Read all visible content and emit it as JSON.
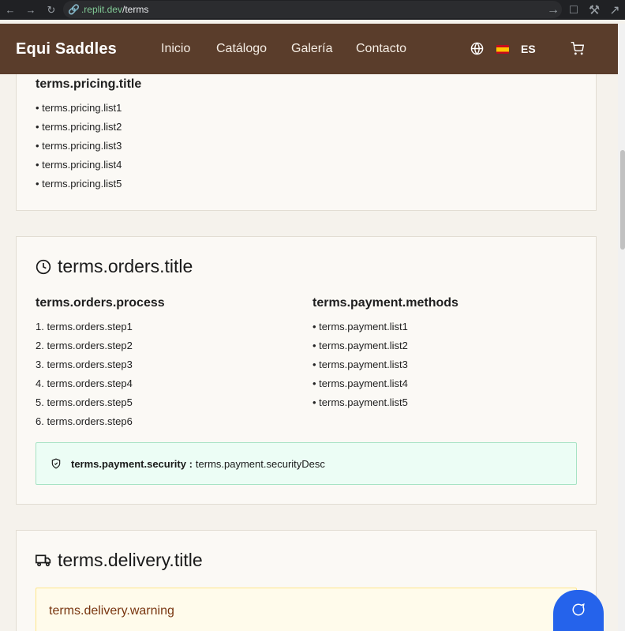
{
  "browser": {
    "url_domain": ".replit.dev",
    "url_path": "/terms"
  },
  "header": {
    "brand": "Equi Saddles",
    "nav": [
      "Inicio",
      "Catálogo",
      "Galería",
      "Contacto"
    ],
    "language": "ES"
  },
  "pricing": {
    "title": "terms.pricing.title",
    "items": [
      "terms.pricing.list1",
      "terms.pricing.list2",
      "terms.pricing.list3",
      "terms.pricing.list4",
      "terms.pricing.list5"
    ]
  },
  "orders": {
    "title": "terms.orders.title",
    "process_title": "terms.orders.process",
    "steps": [
      "1. terms.orders.step1",
      "2. terms.orders.step2",
      "3. terms.orders.step3",
      "4. terms.orders.step4",
      "5. terms.orders.step5",
      "6. terms.orders.step6"
    ],
    "payment_title": "terms.payment.methods",
    "payment_items": [
      "terms.payment.list1",
      "terms.payment.list2",
      "terms.payment.list3",
      "terms.payment.list4",
      "terms.payment.list5"
    ],
    "security_label": "terms.payment.security :",
    "security_desc": "terms.payment.securityDesc"
  },
  "delivery": {
    "title": "terms.delivery.title",
    "warning": "terms.delivery.warning"
  },
  "colors": {
    "header_bg": "#5a3d2b",
    "chat_button": "#2563eb",
    "security_bg": "#ecfdf5",
    "warning_bg": "#fffbeb"
  }
}
